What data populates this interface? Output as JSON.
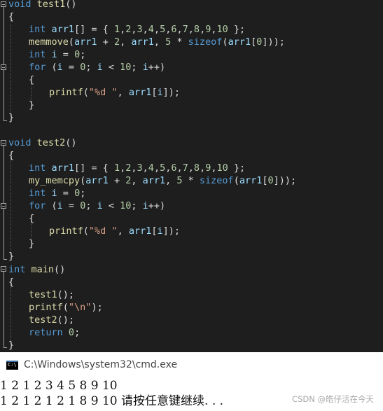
{
  "editor": {
    "lines": [
      {
        "y": 0,
        "tokens": [
          [
            "kw",
            "void"
          ],
          [
            "pl",
            " "
          ],
          [
            "fn",
            "test1"
          ],
          [
            "pl",
            "()"
          ]
        ]
      },
      {
        "y": 1,
        "tokens": [
          [
            "pl",
            "{"
          ]
        ]
      },
      {
        "y": 2,
        "tokens": [
          [
            "kw",
            "int"
          ],
          [
            "pl",
            " "
          ],
          [
            "var",
            "arr1"
          ],
          [
            "pl",
            "[] = { "
          ],
          [
            "num",
            "1"
          ],
          [
            "pl",
            ","
          ],
          [
            "num",
            "2"
          ],
          [
            "pl",
            ","
          ],
          [
            "num",
            "3"
          ],
          [
            "pl",
            ","
          ],
          [
            "num",
            "4"
          ],
          [
            "pl",
            ","
          ],
          [
            "num",
            "5"
          ],
          [
            "pl",
            ","
          ],
          [
            "num",
            "6"
          ],
          [
            "pl",
            ","
          ],
          [
            "num",
            "7"
          ],
          [
            "pl",
            ","
          ],
          [
            "num",
            "8"
          ],
          [
            "pl",
            ","
          ],
          [
            "num",
            "9"
          ],
          [
            "pl",
            ","
          ],
          [
            "num",
            "10"
          ],
          [
            "pl",
            " };"
          ]
        ]
      },
      {
        "y": 3,
        "tokens": [
          [
            "fn",
            "memmove"
          ],
          [
            "pl",
            "("
          ],
          [
            "var",
            "arr1"
          ],
          [
            "pl",
            " + "
          ],
          [
            "num",
            "2"
          ],
          [
            "pl",
            ", "
          ],
          [
            "var",
            "arr1"
          ],
          [
            "pl",
            ", "
          ],
          [
            "num",
            "5"
          ],
          [
            "pl",
            " * "
          ],
          [
            "kw",
            "sizeof"
          ],
          [
            "pl",
            "("
          ],
          [
            "var",
            "arr1"
          ],
          [
            "pl",
            "["
          ],
          [
            "num",
            "0"
          ],
          [
            "pl",
            "]));"
          ]
        ]
      },
      {
        "y": 4,
        "tokens": [
          [
            "kw",
            "int"
          ],
          [
            "pl",
            " "
          ],
          [
            "var",
            "i"
          ],
          [
            "pl",
            " = "
          ],
          [
            "num",
            "0"
          ],
          [
            "pl",
            ";"
          ]
        ]
      },
      {
        "y": 5,
        "tokens": [
          [
            "kw",
            "for"
          ],
          [
            "pl",
            " ("
          ],
          [
            "var",
            "i"
          ],
          [
            "pl",
            " = "
          ],
          [
            "num",
            "0"
          ],
          [
            "pl",
            "; "
          ],
          [
            "var",
            "i"
          ],
          [
            "pl",
            " < "
          ],
          [
            "num",
            "10"
          ],
          [
            "pl",
            "; "
          ],
          [
            "var",
            "i"
          ],
          [
            "pl",
            "++)"
          ]
        ]
      },
      {
        "y": 6,
        "tokens": [
          [
            "pl",
            "{"
          ]
        ]
      },
      {
        "y": 7,
        "tokens": [
          [
            "fn",
            "printf"
          ],
          [
            "pl",
            "("
          ],
          [
            "str",
            "\"%d \""
          ],
          [
            "pl",
            ", "
          ],
          [
            "var",
            "arr1"
          ],
          [
            "pl",
            "["
          ],
          [
            "var",
            "i"
          ],
          [
            "pl",
            "]);"
          ]
        ]
      },
      {
        "y": 8,
        "tokens": [
          [
            "pl",
            "}"
          ]
        ]
      },
      {
        "y": 9,
        "tokens": [
          [
            "pl",
            "}"
          ]
        ]
      },
      {
        "y": 11,
        "tokens": [
          [
            "kw",
            "void"
          ],
          [
            "pl",
            " "
          ],
          [
            "fn",
            "test2"
          ],
          [
            "pl",
            "()"
          ]
        ]
      },
      {
        "y": 12,
        "tokens": [
          [
            "pl",
            "{"
          ]
        ]
      },
      {
        "y": 13,
        "tokens": [
          [
            "kw",
            "int"
          ],
          [
            "pl",
            " "
          ],
          [
            "var",
            "arr1"
          ],
          [
            "pl",
            "[] = { "
          ],
          [
            "num",
            "1"
          ],
          [
            "pl",
            ","
          ],
          [
            "num",
            "2"
          ],
          [
            "pl",
            ","
          ],
          [
            "num",
            "3"
          ],
          [
            "pl",
            ","
          ],
          [
            "num",
            "4"
          ],
          [
            "pl",
            ","
          ],
          [
            "num",
            "5"
          ],
          [
            "pl",
            ","
          ],
          [
            "num",
            "6"
          ],
          [
            "pl",
            ","
          ],
          [
            "num",
            "7"
          ],
          [
            "pl",
            ","
          ],
          [
            "num",
            "8"
          ],
          [
            "pl",
            ","
          ],
          [
            "num",
            "9"
          ],
          [
            "pl",
            ","
          ],
          [
            "num",
            "10"
          ],
          [
            "pl",
            " };"
          ]
        ]
      },
      {
        "y": 14,
        "tokens": [
          [
            "fn",
            "my_memcpy"
          ],
          [
            "pl",
            "("
          ],
          [
            "var",
            "arr1"
          ],
          [
            "pl",
            " + "
          ],
          [
            "num",
            "2"
          ],
          [
            "pl",
            ", "
          ],
          [
            "var",
            "arr1"
          ],
          [
            "pl",
            ", "
          ],
          [
            "num",
            "5"
          ],
          [
            "pl",
            " * "
          ],
          [
            "kw",
            "sizeof"
          ],
          [
            "pl",
            "("
          ],
          [
            "var",
            "arr1"
          ],
          [
            "pl",
            "["
          ],
          [
            "num",
            "0"
          ],
          [
            "pl",
            "]));"
          ]
        ]
      },
      {
        "y": 15,
        "tokens": [
          [
            "kw",
            "int"
          ],
          [
            "pl",
            " "
          ],
          [
            "var",
            "i"
          ],
          [
            "pl",
            " = "
          ],
          [
            "num",
            "0"
          ],
          [
            "pl",
            ";"
          ]
        ]
      },
      {
        "y": 16,
        "tokens": [
          [
            "kw",
            "for"
          ],
          [
            "pl",
            " ("
          ],
          [
            "var",
            "i"
          ],
          [
            "pl",
            " = "
          ],
          [
            "num",
            "0"
          ],
          [
            "pl",
            "; "
          ],
          [
            "var",
            "i"
          ],
          [
            "pl",
            " < "
          ],
          [
            "num",
            "10"
          ],
          [
            "pl",
            "; "
          ],
          [
            "var",
            "i"
          ],
          [
            "pl",
            "++)"
          ]
        ]
      },
      {
        "y": 17,
        "tokens": [
          [
            "pl",
            "{"
          ]
        ]
      },
      {
        "y": 18,
        "tokens": [
          [
            "fn",
            "printf"
          ],
          [
            "pl",
            "("
          ],
          [
            "str",
            "\"%d \""
          ],
          [
            "pl",
            ", "
          ],
          [
            "var",
            "arr1"
          ],
          [
            "pl",
            "["
          ],
          [
            "var",
            "i"
          ],
          [
            "pl",
            "]);"
          ]
        ]
      },
      {
        "y": 19,
        "tokens": [
          [
            "pl",
            "}"
          ]
        ]
      },
      {
        "y": 20,
        "tokens": [
          [
            "pl",
            "}"
          ]
        ]
      },
      {
        "y": 21,
        "tokens": [
          [
            "kw",
            "int"
          ],
          [
            "pl",
            " "
          ],
          [
            "fn",
            "main"
          ],
          [
            "pl",
            "()"
          ]
        ]
      },
      {
        "y": 22,
        "tokens": [
          [
            "pl",
            "{"
          ]
        ]
      },
      {
        "y": 23,
        "tokens": [
          [
            "fn",
            "test1"
          ],
          [
            "pl",
            "();"
          ]
        ]
      },
      {
        "y": 24,
        "tokens": [
          [
            "fn",
            "printf"
          ],
          [
            "pl",
            "("
          ],
          [
            "str",
            "\"\\n\""
          ],
          [
            "pl",
            ");"
          ]
        ]
      },
      {
        "y": 25,
        "tokens": [
          [
            "fn",
            "test2"
          ],
          [
            "pl",
            "();"
          ]
        ]
      },
      {
        "y": 26,
        "tokens": [
          [
            "kw",
            "return"
          ],
          [
            "pl",
            " "
          ],
          [
            "num",
            "0"
          ],
          [
            "pl",
            ";"
          ]
        ]
      },
      {
        "y": 27,
        "tokens": [
          [
            "pl",
            "}"
          ]
        ]
      }
    ]
  },
  "console": {
    "title": "C:\\Windows\\system32\\cmd.exe",
    "icon_text": "C:\\",
    "output_line1": "1 2 1 2 3 4 5 8 9 10",
    "output_line2": "1 2 1 2 1 2 1 8 9 10 请按任意键继续. . .",
    "watermark": "CSDN @皓仔活在今天"
  },
  "colors": {
    "editor_bg": "#1e1e1e",
    "keyword": "#569cd6",
    "function": "#dcdcaa",
    "variable": "#9cdcfe",
    "number": "#b5cea8",
    "string": "#d69d85",
    "plain": "#dcdcdc"
  }
}
